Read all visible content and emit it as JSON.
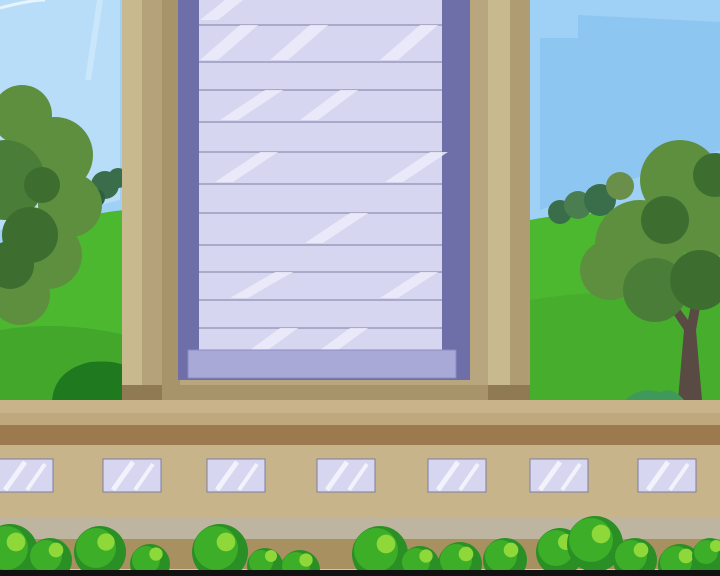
{
  "scene": {
    "name": "building-window-exterior",
    "elements": [
      "sky",
      "hills",
      "trees",
      "building-pillar",
      "sliding-glass-door",
      "stone-ledge",
      "basement-windows",
      "hedge"
    ]
  },
  "palette": {
    "sky": "#9fd0f5",
    "sky_light": "#c6e6fb",
    "grass": "#4cb830",
    "grass_dark": "#2f8f24",
    "tree_leaf": "#5e8f3e",
    "tree_leaf_dark": "#3d6e30",
    "trunk": "#5a4a44",
    "pillar": "#c9b98f",
    "pillar_shadow": "#a8946a",
    "door_frame": "#6e6ea8",
    "glass": "#d6d6f0",
    "glass_sill": "#a9a9d8",
    "ledge": "#c8b48a",
    "ledge_dark": "#9a7a4e",
    "hedge": "#3cae28"
  },
  "basement_window_count": 7,
  "door_slat_count": 11
}
